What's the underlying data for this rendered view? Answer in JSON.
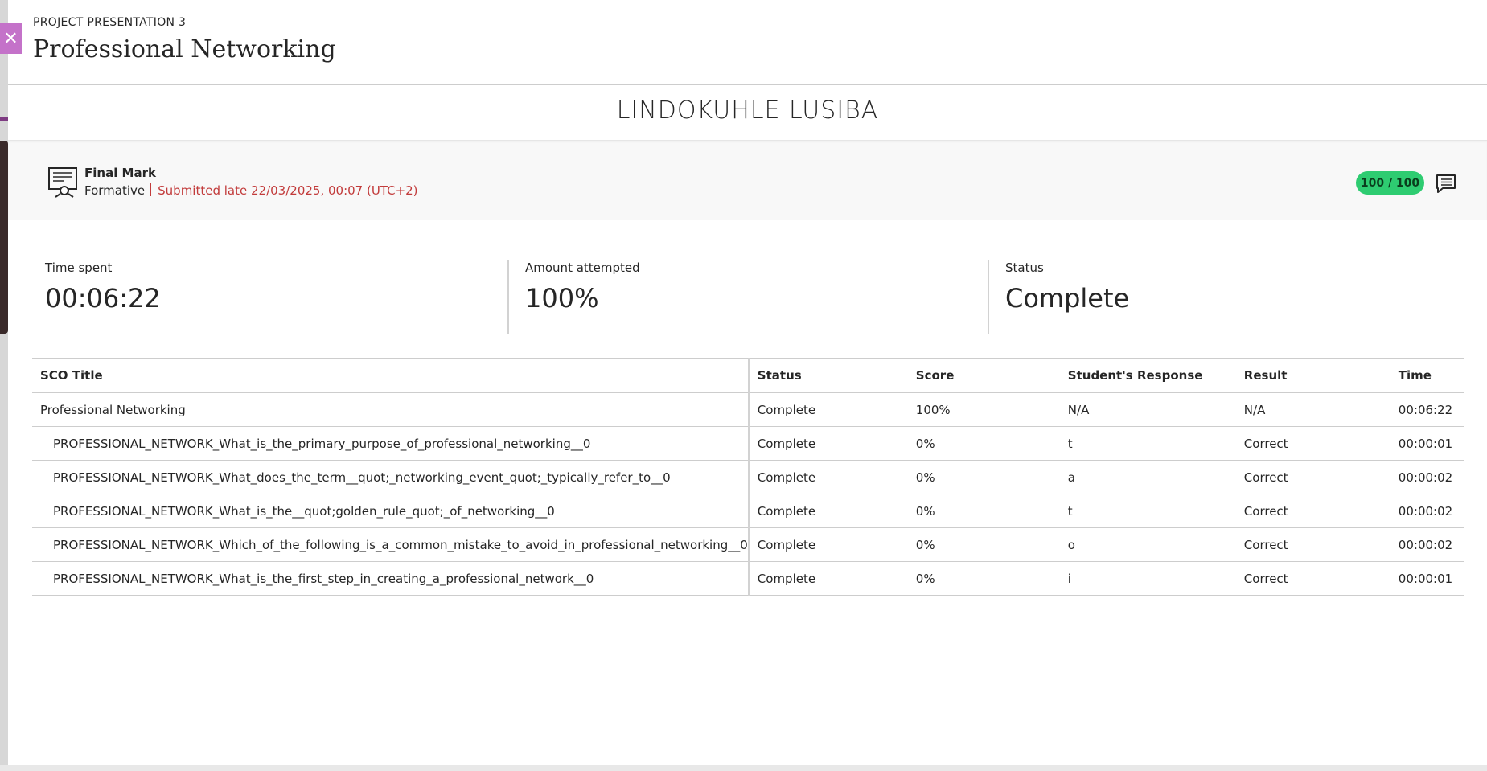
{
  "header": {
    "kicker": "PROJECT PRESENTATION 3",
    "title": "Professional Networking",
    "close_icon": "close-icon"
  },
  "student": {
    "name": "LINDOKUHLE LUSIBA"
  },
  "grade": {
    "icon": "presentation-board-icon",
    "label": "Final Mark",
    "type": "Formative",
    "submission": "Submitted late 22/03/2025, 00:07 (UTC+2)",
    "score": "100 / 100",
    "feedback_icon": "comment-icon",
    "colors": {
      "pill": "#2ecc71",
      "late": "#c23b3b"
    }
  },
  "stats": [
    {
      "label": "Time spent",
      "value": "00:06:22"
    },
    {
      "label": "Amount attempted",
      "value": "100%"
    },
    {
      "label": "Status",
      "value": "Complete"
    }
  ],
  "table": {
    "headers": [
      "SCO Title",
      "Status",
      "Score",
      "Student's Response",
      "Result",
      "Time"
    ],
    "rows": [
      {
        "title": "Professional Networking",
        "status": "Complete",
        "score": "100%",
        "response": "N/A",
        "result": "N/A",
        "time": "00:06:22"
      },
      {
        "title": "PROFESSIONAL_NETWORK_What_is_the_primary_purpose_of_professional_networking__0",
        "status": "Complete",
        "score": "0%",
        "response": "t",
        "result": "Correct",
        "time": "00:00:01"
      },
      {
        "title": "PROFESSIONAL_NETWORK_What_does_the_term__quot;_networking_event_quot;_typically_refer_to__0",
        "status": "Complete",
        "score": "0%",
        "response": "a",
        "result": "Correct",
        "time": "00:00:02"
      },
      {
        "title": "PROFESSIONAL_NETWORK_What_is_the__quot;golden_rule_quot;_of_networking__0",
        "status": "Complete",
        "score": "0%",
        "response": "t",
        "result": "Correct",
        "time": "00:00:02"
      },
      {
        "title": "PROFESSIONAL_NETWORK_Which_of_the_following_is_a_common_mistake_to_avoid_in_professional_networking__0",
        "status": "Complete",
        "score": "0%",
        "response": "o",
        "result": "Correct",
        "time": "00:00:02"
      },
      {
        "title": "PROFESSIONAL_NETWORK_What_is_the_first_step_in_creating_a_professional_network__0",
        "status": "Complete",
        "score": "0%",
        "response": "i",
        "result": "Correct",
        "time": "00:00:01"
      }
    ]
  }
}
